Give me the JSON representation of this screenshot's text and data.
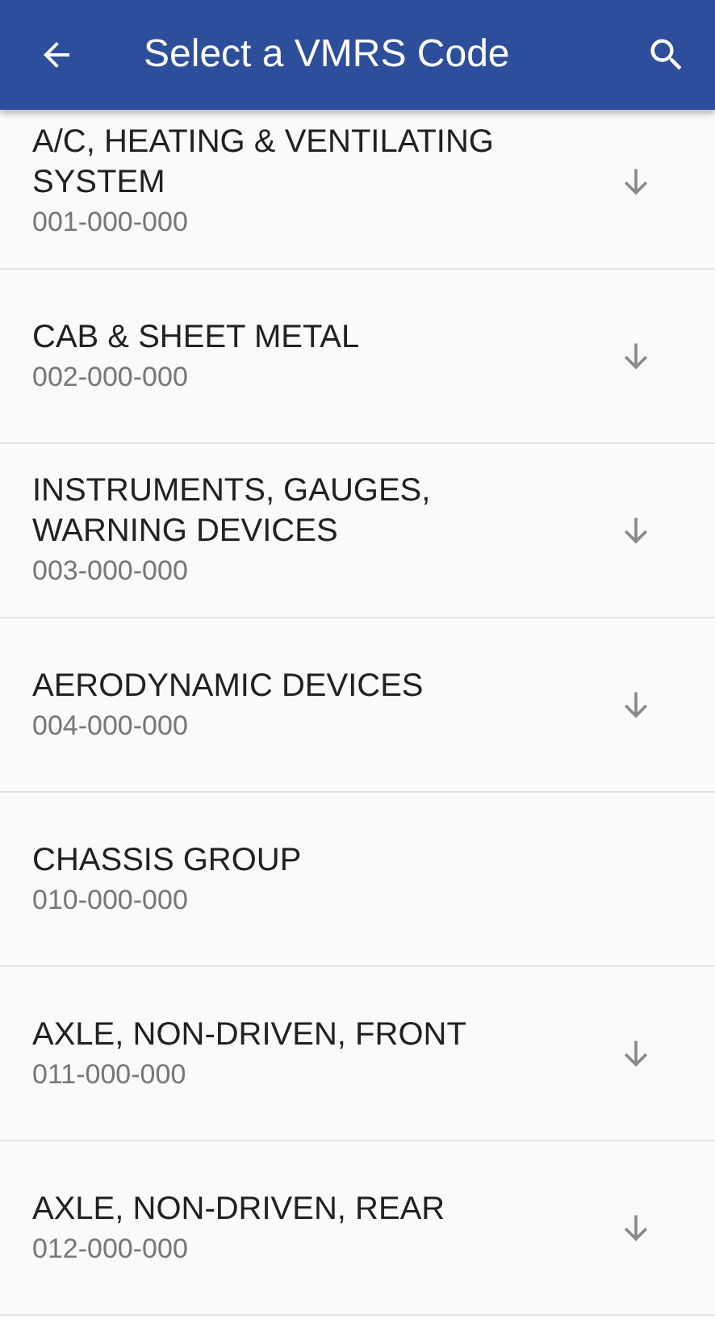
{
  "app_bar": {
    "title": "Select a VMRS Code"
  },
  "codes": [
    {
      "name": "A/C, HEATING & VENTILATING SYSTEM",
      "code": "001-000-000",
      "has_children": true
    },
    {
      "name": "CAB & SHEET METAL",
      "code": "002-000-000",
      "has_children": true
    },
    {
      "name": "INSTRUMENTS, GAUGES, WARNING DEVICES",
      "code": "003-000-000",
      "has_children": true
    },
    {
      "name": "AERODYNAMIC DEVICES",
      "code": "004-000-000",
      "has_children": true
    },
    {
      "name": "CHASSIS GROUP",
      "code": "010-000-000",
      "has_children": false
    },
    {
      "name": "AXLE, NON-DRIVEN, FRONT",
      "code": "011-000-000",
      "has_children": true
    },
    {
      "name": "AXLE, NON-DRIVEN, REAR",
      "code": "012-000-000",
      "has_children": true
    }
  ]
}
